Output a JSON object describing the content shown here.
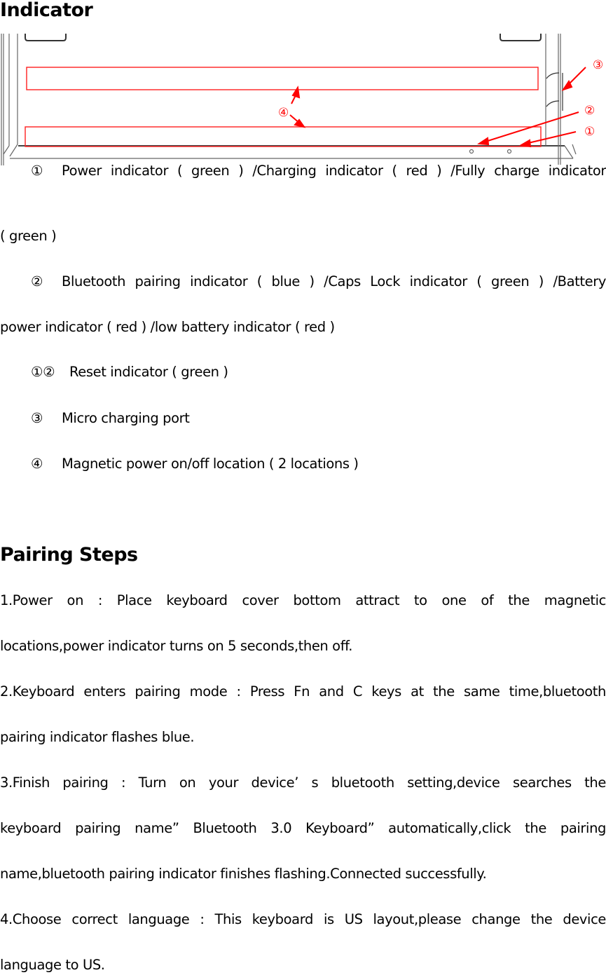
{
  "indicator_section": {
    "title": "Indicator",
    "diagram": {
      "callouts": [
        "③",
        "④",
        "②",
        "①"
      ],
      "accent_color": "#ff0000",
      "outline_color": "#555555"
    },
    "items": [
      {
        "marker": "①",
        "text_line1": "Power indicator ( green ) /Charging indicator ( red ) /Fully charge indicator",
        "text_line2": " ( green )"
      },
      {
        "marker": "②",
        "text_line1": "Bluetooth pairing indicator ( blue ) /Caps Lock indicator ( green ) /Battery",
        "text_line2": "power indicator ( red ) /low battery indicator ( red )"
      },
      {
        "marker": "①②",
        "text_line1": "Reset indicator ( green )"
      },
      {
        "marker": "③",
        "text_line1": "Micro charging port"
      },
      {
        "marker": "④",
        "text_line1": "Magnetic power on/off location ( 2 locations )"
      }
    ]
  },
  "pairing_section": {
    "title": "Pairing Steps",
    "lines": [
      "1.Power on : Place keyboard cover bottom attract to one of the magnetic",
      "locations,power indicator turns on 5 seconds,then off.",
      "2.Keyboard enters pairing mode : Press Fn and C keys at the same time,bluetooth",
      "pairing indicator flashes blue.",
      "3.Finish pairing : Turn on your device’ s  bluetooth setting,device searches the",
      "keyboard pairing name” Bluetooth 3.0 Keyboard”  automatically,click the pairing",
      "name,bluetooth pairing indicator finishes flashing.Connected successfully.",
      "4.Choose correct language : This keyboard is US layout,please change the device",
      "language to US."
    ]
  }
}
